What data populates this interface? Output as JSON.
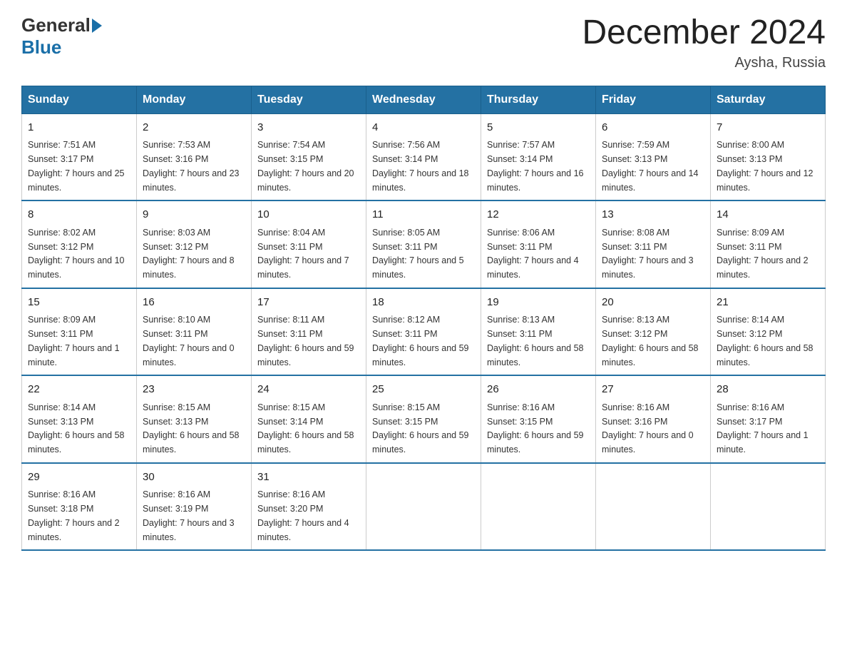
{
  "header": {
    "logo_general": "General",
    "logo_blue": "Blue",
    "month_title": "December 2024",
    "location": "Aysha, Russia"
  },
  "days_of_week": [
    "Sunday",
    "Monday",
    "Tuesday",
    "Wednesday",
    "Thursday",
    "Friday",
    "Saturday"
  ],
  "weeks": [
    [
      {
        "day": "1",
        "sunrise": "7:51 AM",
        "sunset": "3:17 PM",
        "daylight": "7 hours and 25 minutes."
      },
      {
        "day": "2",
        "sunrise": "7:53 AM",
        "sunset": "3:16 PM",
        "daylight": "7 hours and 23 minutes."
      },
      {
        "day": "3",
        "sunrise": "7:54 AM",
        "sunset": "3:15 PM",
        "daylight": "7 hours and 20 minutes."
      },
      {
        "day": "4",
        "sunrise": "7:56 AM",
        "sunset": "3:14 PM",
        "daylight": "7 hours and 18 minutes."
      },
      {
        "day": "5",
        "sunrise": "7:57 AM",
        "sunset": "3:14 PM",
        "daylight": "7 hours and 16 minutes."
      },
      {
        "day": "6",
        "sunrise": "7:59 AM",
        "sunset": "3:13 PM",
        "daylight": "7 hours and 14 minutes."
      },
      {
        "day": "7",
        "sunrise": "8:00 AM",
        "sunset": "3:13 PM",
        "daylight": "7 hours and 12 minutes."
      }
    ],
    [
      {
        "day": "8",
        "sunrise": "8:02 AM",
        "sunset": "3:12 PM",
        "daylight": "7 hours and 10 minutes."
      },
      {
        "day": "9",
        "sunrise": "8:03 AM",
        "sunset": "3:12 PM",
        "daylight": "7 hours and 8 minutes."
      },
      {
        "day": "10",
        "sunrise": "8:04 AM",
        "sunset": "3:11 PM",
        "daylight": "7 hours and 7 minutes."
      },
      {
        "day": "11",
        "sunrise": "8:05 AM",
        "sunset": "3:11 PM",
        "daylight": "7 hours and 5 minutes."
      },
      {
        "day": "12",
        "sunrise": "8:06 AM",
        "sunset": "3:11 PM",
        "daylight": "7 hours and 4 minutes."
      },
      {
        "day": "13",
        "sunrise": "8:08 AM",
        "sunset": "3:11 PM",
        "daylight": "7 hours and 3 minutes."
      },
      {
        "day": "14",
        "sunrise": "8:09 AM",
        "sunset": "3:11 PM",
        "daylight": "7 hours and 2 minutes."
      }
    ],
    [
      {
        "day": "15",
        "sunrise": "8:09 AM",
        "sunset": "3:11 PM",
        "daylight": "7 hours and 1 minute."
      },
      {
        "day": "16",
        "sunrise": "8:10 AM",
        "sunset": "3:11 PM",
        "daylight": "7 hours and 0 minutes."
      },
      {
        "day": "17",
        "sunrise": "8:11 AM",
        "sunset": "3:11 PM",
        "daylight": "6 hours and 59 minutes."
      },
      {
        "day": "18",
        "sunrise": "8:12 AM",
        "sunset": "3:11 PM",
        "daylight": "6 hours and 59 minutes."
      },
      {
        "day": "19",
        "sunrise": "8:13 AM",
        "sunset": "3:11 PM",
        "daylight": "6 hours and 58 minutes."
      },
      {
        "day": "20",
        "sunrise": "8:13 AM",
        "sunset": "3:12 PM",
        "daylight": "6 hours and 58 minutes."
      },
      {
        "day": "21",
        "sunrise": "8:14 AM",
        "sunset": "3:12 PM",
        "daylight": "6 hours and 58 minutes."
      }
    ],
    [
      {
        "day": "22",
        "sunrise": "8:14 AM",
        "sunset": "3:13 PM",
        "daylight": "6 hours and 58 minutes."
      },
      {
        "day": "23",
        "sunrise": "8:15 AM",
        "sunset": "3:13 PM",
        "daylight": "6 hours and 58 minutes."
      },
      {
        "day": "24",
        "sunrise": "8:15 AM",
        "sunset": "3:14 PM",
        "daylight": "6 hours and 58 minutes."
      },
      {
        "day": "25",
        "sunrise": "8:15 AM",
        "sunset": "3:15 PM",
        "daylight": "6 hours and 59 minutes."
      },
      {
        "day": "26",
        "sunrise": "8:16 AM",
        "sunset": "3:15 PM",
        "daylight": "6 hours and 59 minutes."
      },
      {
        "day": "27",
        "sunrise": "8:16 AM",
        "sunset": "3:16 PM",
        "daylight": "7 hours and 0 minutes."
      },
      {
        "day": "28",
        "sunrise": "8:16 AM",
        "sunset": "3:17 PM",
        "daylight": "7 hours and 1 minute."
      }
    ],
    [
      {
        "day": "29",
        "sunrise": "8:16 AM",
        "sunset": "3:18 PM",
        "daylight": "7 hours and 2 minutes."
      },
      {
        "day": "30",
        "sunrise": "8:16 AM",
        "sunset": "3:19 PM",
        "daylight": "7 hours and 3 minutes."
      },
      {
        "day": "31",
        "sunrise": "8:16 AM",
        "sunset": "3:20 PM",
        "daylight": "7 hours and 4 minutes."
      },
      null,
      null,
      null,
      null
    ]
  ]
}
